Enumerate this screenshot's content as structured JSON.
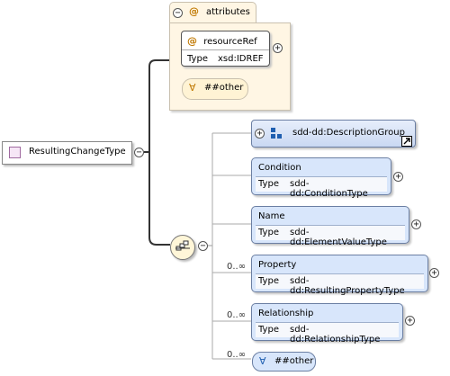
{
  "root": {
    "label": "ResultingChangeType"
  },
  "attributes": {
    "header": "attributes",
    "resource_ref": {
      "name": "resourceRef",
      "type_key": "Type",
      "type_value": "xsd:IDREF"
    },
    "any_attribute": "##other"
  },
  "elements": {
    "description_group": {
      "name": "sdd-dd:DescriptionGroup"
    },
    "condition": {
      "name": "Condition",
      "type_key": "Type",
      "type_value": "sdd-dd:ConditionType"
    },
    "name": {
      "name": "Name",
      "type_key": "Type",
      "type_value": "sdd-dd:ElementValueType"
    },
    "property": {
      "name": "Property",
      "type_key": "Type",
      "type_value": "sdd-dd:ResultingPropertyType",
      "cardinality": "0..∞"
    },
    "relationship": {
      "name": "Relationship",
      "type_key": "Type",
      "type_value": "sdd-dd:RelationshipType",
      "cardinality": "0..∞"
    },
    "any_element": {
      "name": "##other",
      "cardinality": "0..∞"
    }
  },
  "glyphs": {
    "at": "@",
    "any": "∀",
    "minus": "−",
    "plus": "+"
  },
  "colors": {
    "attr_bg": "#fff6e4",
    "element_bg": "#d8e6fb",
    "element_border": "#6b7fa3"
  }
}
